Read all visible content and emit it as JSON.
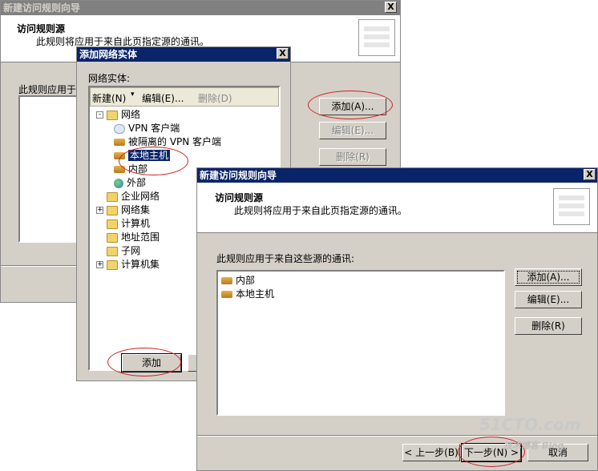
{
  "back_window": {
    "title": "新建访问规则向导",
    "close": "X",
    "header_title": "访问规则源",
    "header_sub": "此规则将应用于来自此页指定源的通讯。",
    "apply_label": "此规则应用于",
    "add_button": "添加(A)...",
    "edit_button": "编辑(E)...",
    "delete_button": "删除(R)"
  },
  "add_entity": {
    "title": "添加网络实体",
    "close": "X",
    "entity_label": "网络实体:",
    "toolbar": {
      "new": "新建(N)",
      "edit": "编辑(E)...",
      "delete": "删除(D)"
    },
    "tree": [
      {
        "label": "网络",
        "icon": "folder-open-icon",
        "expander": "-"
      },
      {
        "label": "VPN 客户端",
        "icon": "cloud-icon"
      },
      {
        "label": "被隔离的 VPN 客户端",
        "icon": "network-icon"
      },
      {
        "label": "本地主机",
        "icon": "network-icon",
        "selected": true
      },
      {
        "label": "内部",
        "icon": "network-icon"
      },
      {
        "label": "外部",
        "icon": "globe-icon"
      },
      {
        "label": "企业网络",
        "icon": "folder-icon"
      },
      {
        "label": "网络集",
        "icon": "folder-icon",
        "expander": "+"
      },
      {
        "label": "计算机",
        "icon": "folder-icon"
      },
      {
        "label": "地址范围",
        "icon": "folder-icon"
      },
      {
        "label": "子网",
        "icon": "folder-icon"
      },
      {
        "label": "计算机集",
        "icon": "folder-icon",
        "expander": "+"
      }
    ],
    "add_button": "添加"
  },
  "front_window": {
    "title": "新建访问规则向导",
    "close": "X",
    "header_title": "访问规则源",
    "header_sub": "此规则将应用于来自此页指定源的通讯。",
    "apply_label": "此规则应用于来自这些源的通讯:",
    "sources": [
      "内部",
      "本地主机"
    ],
    "add_button": "添加(A)...",
    "edit_button": "编辑(E)...",
    "delete_button": "删除(R)",
    "back_button": "< 上一步(B)",
    "next_button": "下一步(N) >",
    "cancel_button": "取消"
  },
  "watermark": {
    "logo": "51CTO.com",
    "sub": "技术博客 Blog"
  }
}
